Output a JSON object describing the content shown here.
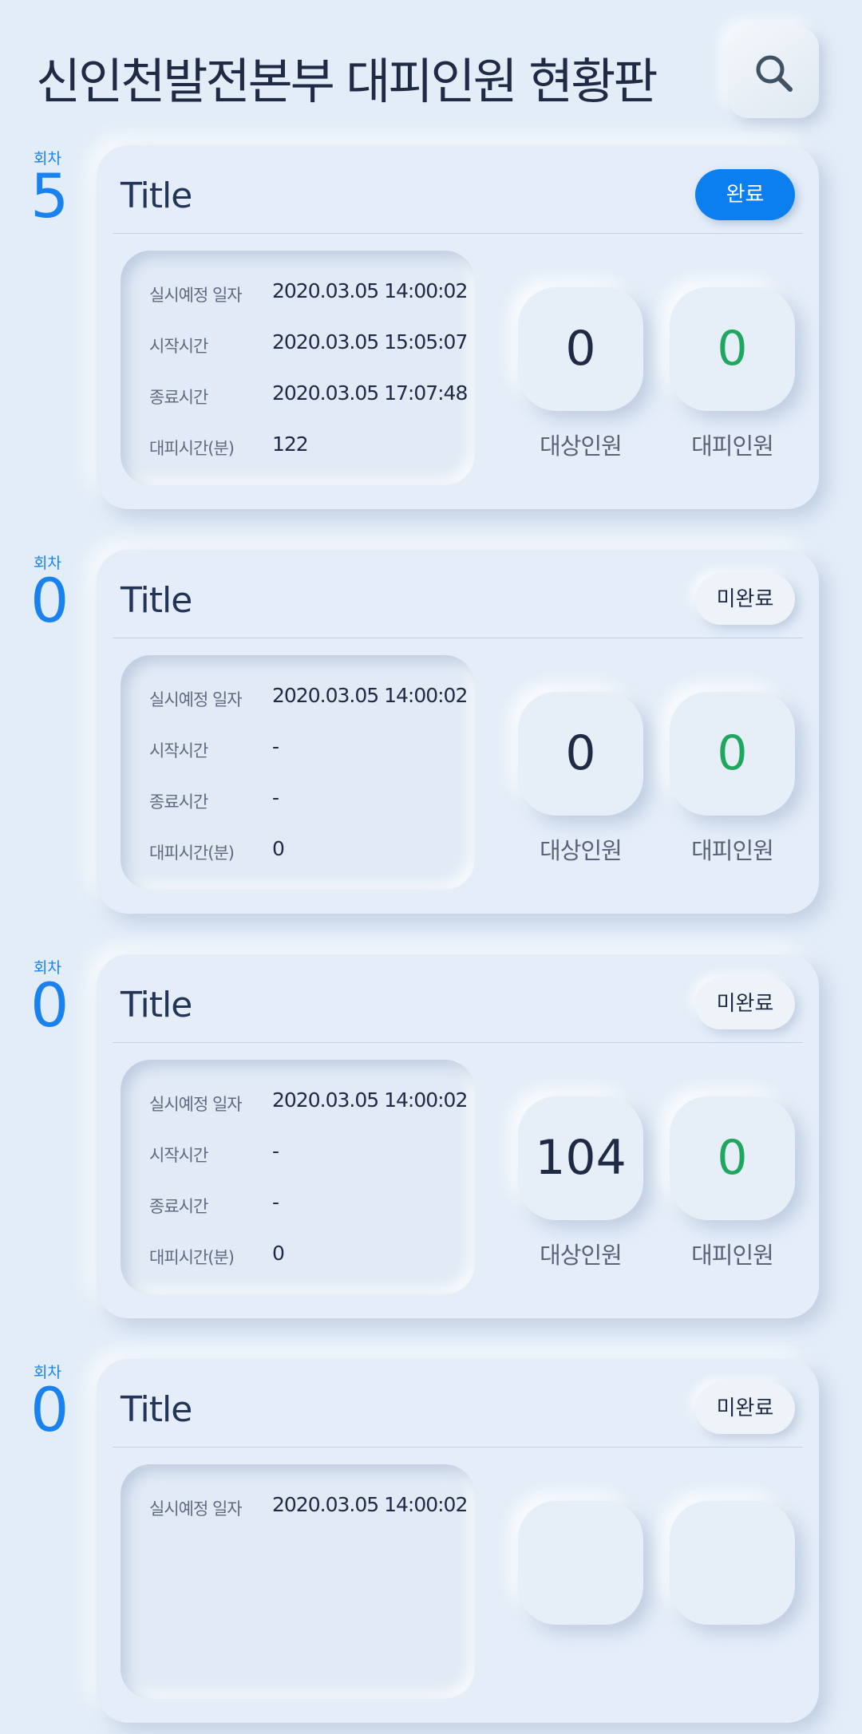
{
  "header": {
    "title": "신인천발전본부 대피인원 현황판",
    "search_icon": "search-icon"
  },
  "labels": {
    "round": "회차",
    "scheduled_date": "실시예정 일자",
    "start_time": "시작시간",
    "end_time": "종료시간",
    "evac_minutes": "대피시간(분)",
    "target": "대상인원",
    "evacuated": "대피인원"
  },
  "colors": {
    "accent": "#1a82ee",
    "done_badge": "#0b7ff0",
    "evacuated_number": "#1fa760",
    "background": "#e3edf8"
  },
  "entries": [
    {
      "round": "5",
      "title": "Title",
      "status": "완료",
      "scheduled_date": "2020.03.05  14:00:02",
      "start_time": "2020.03.05  15:05:07",
      "end_time": "2020.03.05  17:07:48",
      "evac_minutes": "122",
      "target": "0",
      "evacuated": "0"
    },
    {
      "round": "0",
      "title": "Title",
      "status": "미완료",
      "scheduled_date": "2020.03.05  14:00:02",
      "start_time": "-",
      "end_time": "-",
      "evac_minutes": "0",
      "target": "0",
      "evacuated": "0"
    },
    {
      "round": "0",
      "title": "Title",
      "status": "미완료",
      "scheduled_date": "2020.03.05  14:00:02",
      "start_time": "-",
      "end_time": "-",
      "evac_minutes": "0",
      "target": "104",
      "evacuated": "0"
    },
    {
      "round": "0",
      "title": "Title",
      "status": "미완료",
      "scheduled_date": "2020.03.05  14:00:02"
    }
  ]
}
